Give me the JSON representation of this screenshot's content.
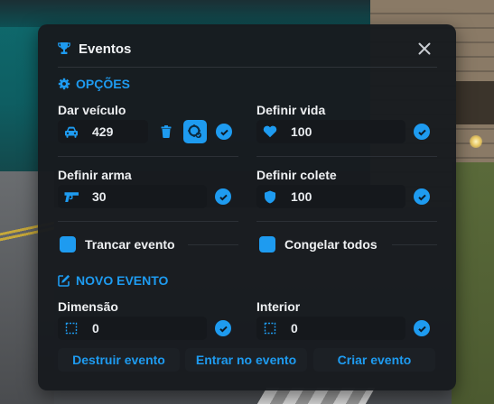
{
  "window": {
    "title": "Eventos"
  },
  "colors": {
    "accent": "#1e9bf0",
    "panel": "#181b1f",
    "text": "#eef0f2"
  },
  "opcoes": {
    "heading": "OPÇÕES",
    "dar_veiculo": {
      "label": "Dar veículo",
      "value": "429",
      "icon": "car-icon"
    },
    "definir_vida": {
      "label": "Definir vida",
      "value": "100",
      "icon": "heart-icon"
    },
    "definir_arma": {
      "label": "Definir arma",
      "value": "30",
      "icon": "gun-icon"
    },
    "definir_colete": {
      "label": "Definir colete",
      "value": "100",
      "icon": "shield-icon"
    },
    "trancar_evento": {
      "label": "Trancar evento",
      "checked": true
    },
    "congelar_todos": {
      "label": "Congelar todos",
      "checked": true
    }
  },
  "novo_evento": {
    "heading": "NOVO EVENTO",
    "dimensao": {
      "label": "Dimensão",
      "value": "0",
      "icon": "dimension-icon"
    },
    "interior": {
      "label": "Interior",
      "value": "0",
      "icon": "dimension-icon"
    }
  },
  "actions": {
    "destruir": "Destruir evento",
    "entrar": "Entrar no evento",
    "criar": "Criar evento"
  }
}
